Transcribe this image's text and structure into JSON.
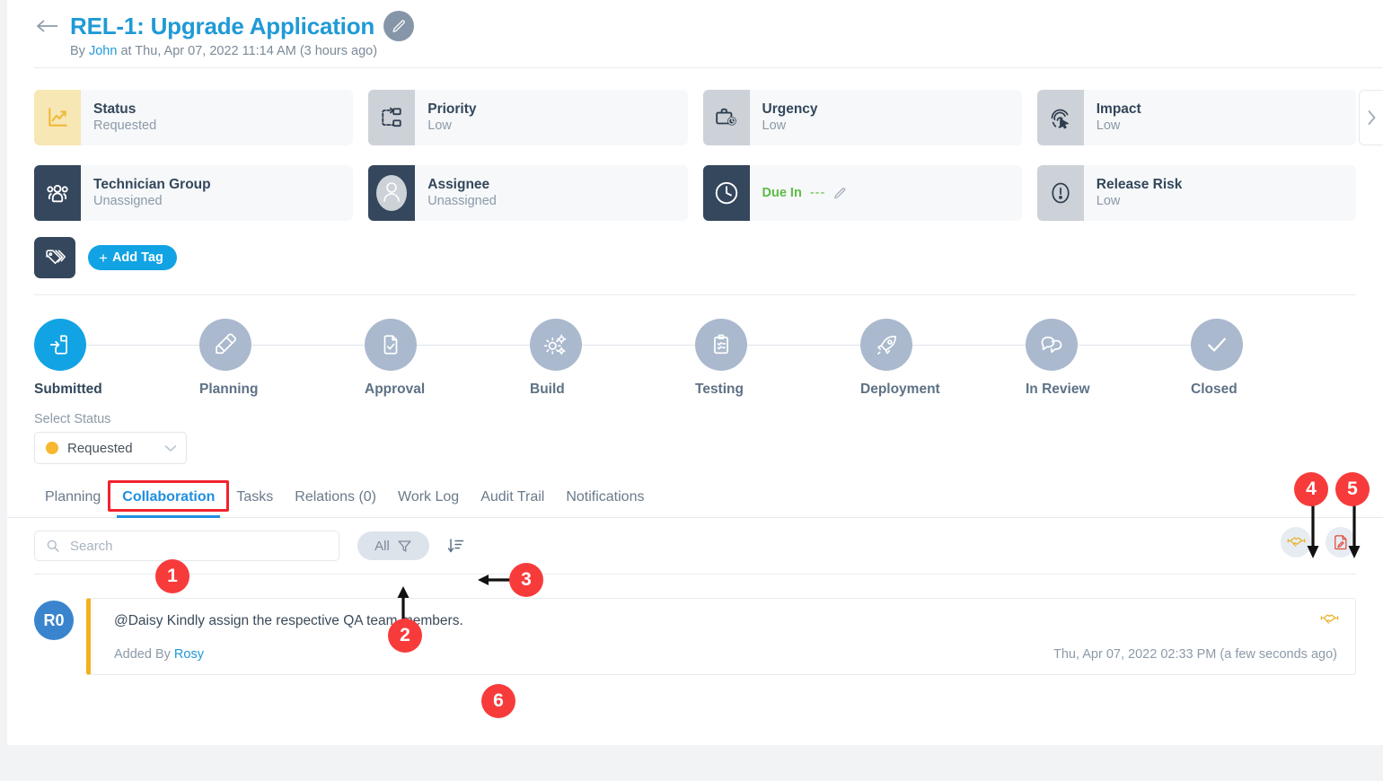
{
  "header": {
    "back_icon": "arrow-left-icon",
    "title": "REL-1: Upgrade Application",
    "edit_icon": "pencil-icon",
    "byline_prefix": "By",
    "byline_user": "John",
    "byline_rest": "at Thu, Apr 07, 2022 11:14 AM (3 hours ago)"
  },
  "fields": [
    {
      "label": "Status",
      "value": "Requested",
      "icon": "chart-line-icon",
      "tone": "yellow"
    },
    {
      "label": "Priority",
      "value": "Low",
      "icon": "priority-icon",
      "tone": "grey"
    },
    {
      "label": "Urgency",
      "value": "Low",
      "icon": "briefcase-clock-icon",
      "tone": "grey"
    },
    {
      "label": "Impact",
      "value": "Low",
      "icon": "fingerprint-icon",
      "tone": "grey"
    },
    {
      "label": "Technician Group",
      "value": "Unassigned",
      "icon": "people-group-icon",
      "tone": "navy"
    },
    {
      "label": "Assignee",
      "value": "Unassigned",
      "icon": "user-avatar-icon",
      "tone": "navy"
    },
    {
      "label": "Release Risk",
      "value": "Low",
      "icon": "exclamation-circle-icon",
      "tone": "grey"
    }
  ],
  "due": {
    "label": "Due In",
    "value": "---",
    "icon": "clock-icon",
    "edit_icon": "pencil-icon",
    "color": "#5fbb46"
  },
  "scroll_right_icon": "chevron-right-icon",
  "tags": {
    "icon": "tags-icon",
    "add_label": "Add Tag",
    "plus": "+"
  },
  "workflow": {
    "steps": [
      {
        "label": "Submitted",
        "icon": "file-submit-icon",
        "active": true
      },
      {
        "label": "Planning",
        "icon": "planning-icon",
        "active": false
      },
      {
        "label": "Approval",
        "icon": "file-check-icon",
        "active": false
      },
      {
        "label": "Build",
        "icon": "gears-icon",
        "active": false
      },
      {
        "label": "Testing",
        "icon": "clipboard-check-icon",
        "active": false
      },
      {
        "label": "Deployment",
        "icon": "rocket-icon",
        "active": false
      },
      {
        "label": "In Review",
        "icon": "chat-bubbles-icon",
        "active": false
      },
      {
        "label": "Closed",
        "icon": "check-icon",
        "active": false
      }
    ]
  },
  "status_select": {
    "label": "Select Status",
    "value": "Requested",
    "dot_color": "#f7b731",
    "chevron_icon": "chevron-down-icon"
  },
  "tabs": [
    {
      "label": "Planning",
      "active": false
    },
    {
      "label": "Collaboration",
      "active": true
    },
    {
      "label": "Tasks",
      "active": false
    },
    {
      "label": "Relations (0)",
      "active": false
    },
    {
      "label": "Work Log",
      "active": false
    },
    {
      "label": "Audit Trail",
      "active": false
    },
    {
      "label": "Notifications",
      "active": false
    }
  ],
  "toolbar": {
    "search_placeholder": "Search",
    "search_value": "",
    "search_icon": "search-icon",
    "filter_label": "All",
    "filter_icon": "funnel-icon",
    "sort_icon": "sort-descending-icon",
    "action_handshake_icon": "handshake-icon",
    "action_note_icon": "document-pencil-icon"
  },
  "comment": {
    "avatar_initials": "R0",
    "text": "@Daisy Kindly assign the respective QA team members.",
    "added_by_label": "Added By",
    "added_by_user": "Rosy",
    "date": "Thu, Apr 07, 2022 02:33 PM (a few seconds ago)",
    "type_icon": "handshake-icon"
  },
  "annotations": [
    {
      "number": "1"
    },
    {
      "number": "2"
    },
    {
      "number": "3"
    },
    {
      "number": "4"
    },
    {
      "number": "5"
    },
    {
      "number": "6"
    }
  ]
}
